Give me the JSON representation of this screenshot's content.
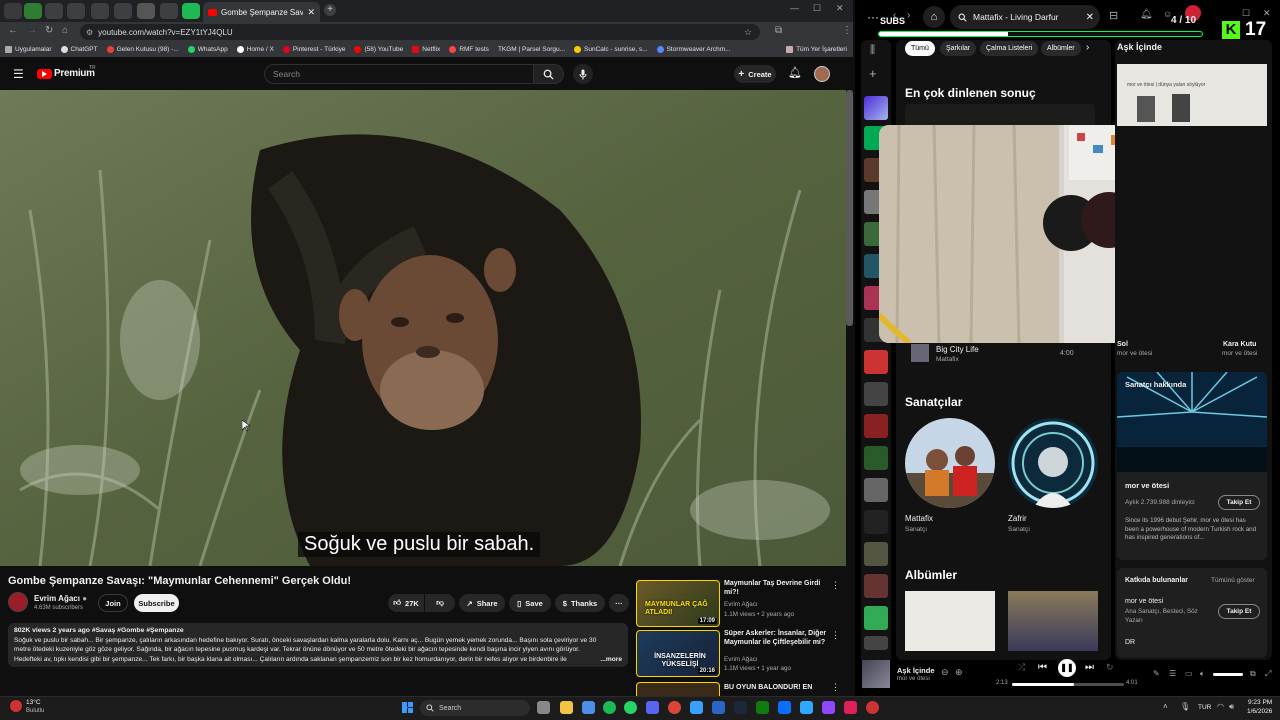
{
  "browser": {
    "active_tab_title": "Gombe Şempanze Savaşı \"Ma",
    "url": "youtube.com/watch?v=EZY1tYJ4QLU",
    "bookmarks": [
      "Uygulamalar",
      "ChatGPT",
      "Gelen Kutusu (98) -...",
      "WhatsApp",
      "Home / X",
      "Pinterest - Türkiye",
      "(58) YouTube",
      "Netflix",
      "RMF tests",
      "TKGM | Parsel Sorgu...",
      "SunCalc - sunrise, s...",
      "Stormweaver Archm..."
    ],
    "all_bookmarks": "Tüm Yer İşaretleri"
  },
  "youtube": {
    "logo": "Premium",
    "logo_sup": "TR",
    "search_placeholder": "Search",
    "create": "Create",
    "caption": "Soğuk ve puslu bir sabah.",
    "title": "Gombe Şempanze Savaşı: \"Maymunlar Cehennemi\" Gerçek Oldu!",
    "channel": "Evrim Ağacı",
    "subscribers": "4.63M subscribers",
    "join": "Join",
    "subscribe": "Subscribe",
    "likes": "27K",
    "share": "Share",
    "save": "Save",
    "thanks": "Thanks",
    "views_line": "802K views  2 years ago  #Savaş #Gombe #Şempanze",
    "desc1": "Soğuk ve puslu bir sabah... Bir şempanze, çalıların arkasından hedefine bakıyor. Suratı, önceki savaşlardan kalma yaralarla dolu. Karnı aç... Bugün yemek yemek zorunda... Başını sola çeviriyor ve 30",
    "desc2": "metre ötedeki kuzeniyle göz göze geliyor. Sağında, bir ağacın tepesine pusmuş kardeşi var. Tekrar önüne dönüyor ve 50 metre ötedeki bir ağacın tepesinde kendi başına incir yiyen avını görüyor.",
    "desc3": "Hedefteki av, tıpkı kendisi gibi bir şempanze... Tek farkı, bir başka klana ait olması... Çalıların ardında saklanan şempanzemiz son bir kez homurdanıyor, derin bir nefes alıyor ve birdenbire ilе",
    "more": "...more",
    "recs": [
      {
        "title": "Maymunlar Taş Devrine Girdi mi?!",
        "channel": "Evrim Ağacı",
        "meta": "1.1M views • 2 years ago",
        "duration": "17:09",
        "thumb_text": "MAYMUNLAR ÇAĞ ATLADI!"
      },
      {
        "title": "Süper Askerler: İnsanlar, Diğer Maymunlar ile Çiftleşebilir mi?",
        "channel": "Evrim Ağacı",
        "meta": "1.1M views • 1 year ago",
        "duration": "20:16",
        "thumb_text": "İNSANZELERİN YÜKSELİŞİ"
      },
      {
        "title": "BU OYUN BALONDUR! EN",
        "channel": "",
        "meta": "",
        "duration": "",
        "thumb_text": ""
      }
    ]
  },
  "spotify": {
    "search_value": "Mattafix - Living Darfur",
    "subs_label": "SUBS",
    "subs_count": "4 / 10",
    "overlay_count": "17",
    "subs_progress": 0.4,
    "chips": [
      "Tümü",
      "Şarkılar",
      "Çalma Listeleri",
      "Albümler"
    ],
    "top_result": "En çok dinlenen sonuç",
    "track": {
      "name": "Big City Life",
      "artist": "Mattafix",
      "duration": "4:00"
    },
    "artists_heading": "Sanatçılar",
    "artists": [
      {
        "name": "Mattafix",
        "role": "Sanatçı"
      },
      {
        "name": "Zafrir",
        "role": "Sanatçı"
      }
    ],
    "albums_heading": "Albümler",
    "right_panel": {
      "title": "Aşk İçinde",
      "card_caption": "mor ve ötesi | dünya yalan söylüyor",
      "item_left_artist": "mor ve ötesi",
      "item_right_artist": "mor ve ötesi",
      "item_right_title": "Kara Kutu",
      "item_left_title": "Sol",
      "about_title": "Sanatçı hakkında",
      "artist": "mor ve ötesi",
      "listeners": "Aylık 2.739.988 dinleyici",
      "follow": "Takip Et",
      "bio": "Since its 1996 debut Şehir, mor ve ötesi has been a powerhouse of modern Turkish rock and has inspired generations of...",
      "credits_title": "Katkıda bulunanlar",
      "show_all": "Tümünü göster",
      "credit_name": "mor ve ötesi",
      "credit_role": "Ana Sanatçı, Besteci, Söz Yazarı",
      "credit_follow": "Takip Et",
      "credit_next": "DR"
    },
    "now_playing": {
      "title": "Aşk İçinde",
      "artist": "mor ve ötesi",
      "elapsed": "2:13",
      "total": "4:01",
      "progress": 0.55
    }
  },
  "taskbar": {
    "weather_temp": "13°C",
    "weather_text": "Bulutlu",
    "search": "Search",
    "lang": "TUR",
    "time": "9:23 PM",
    "date": "1/6/2026"
  }
}
